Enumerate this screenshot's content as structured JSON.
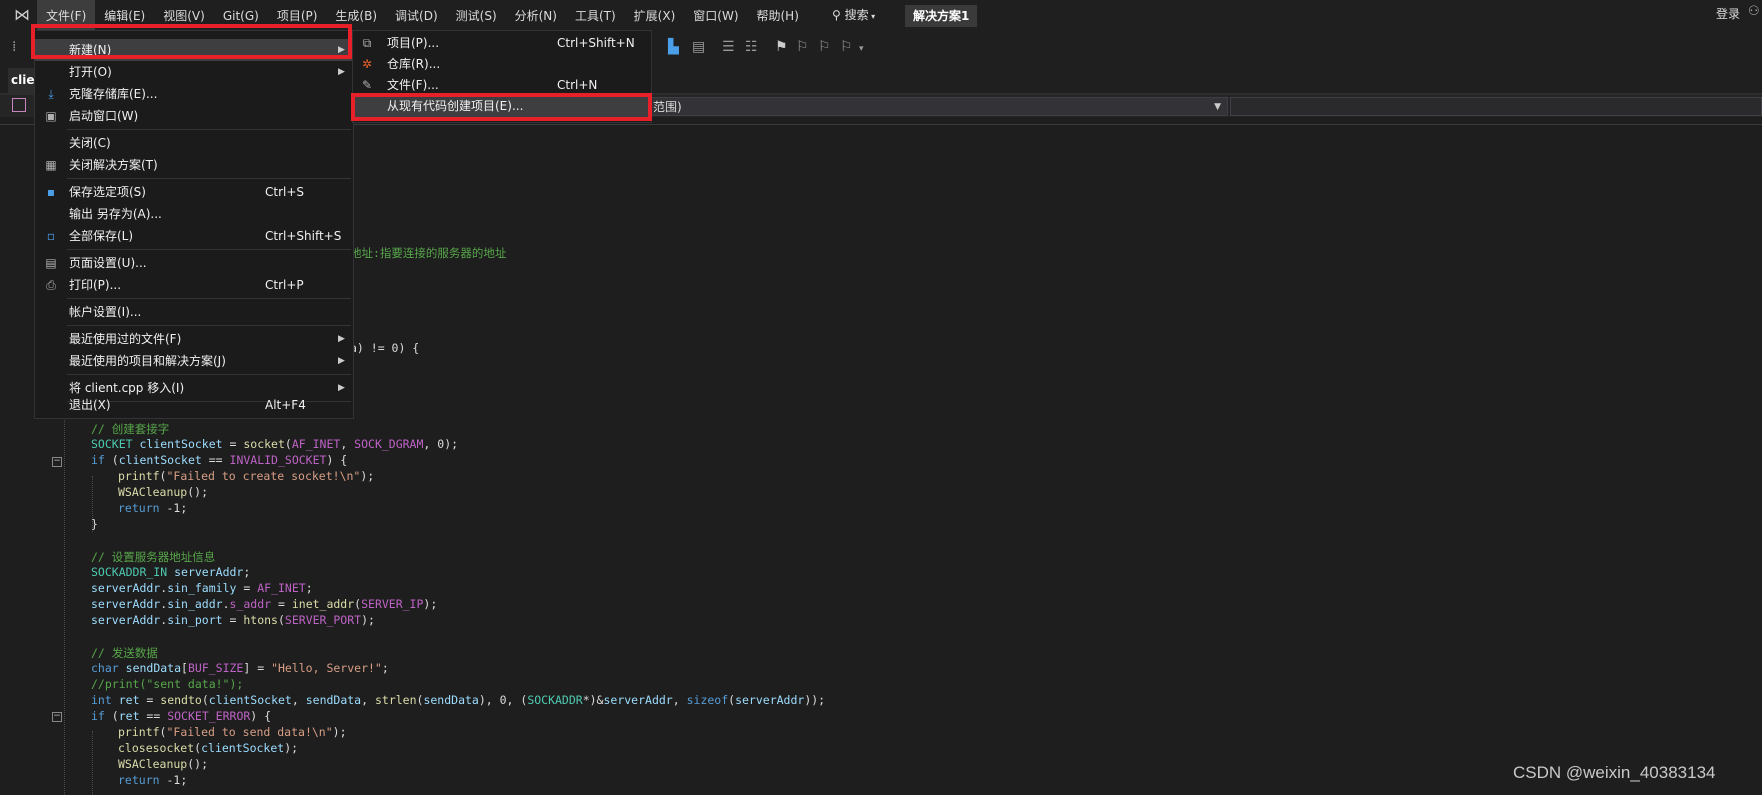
{
  "menubar": {
    "items": [
      "文件(F)",
      "编辑(E)",
      "视图(V)",
      "Git(G)",
      "项目(P)",
      "生成(B)",
      "调试(D)",
      "测试(S)",
      "分析(N)",
      "工具(T)",
      "扩展(X)",
      "窗口(W)",
      "帮助(H)"
    ],
    "search_label": "搜索",
    "solution_name": "解决方案1",
    "login_label": "登录"
  },
  "tab": {
    "title": "clie"
  },
  "navbar": {
    "scope": "局范围)"
  },
  "file_menu": {
    "items": [
      {
        "label": "新建(N)",
        "shortcut": "",
        "submenu": true,
        "icon": ""
      },
      {
        "label": "打开(O)",
        "shortcut": "",
        "submenu": true,
        "icon": ""
      },
      {
        "label": "克隆存储库(E)...",
        "shortcut": "",
        "submenu": false,
        "icon": "clone-icon"
      },
      {
        "label": "启动窗口(W)",
        "shortcut": "",
        "submenu": false,
        "icon": "start-window-icon"
      },
      {
        "label": "关闭(C)",
        "shortcut": "",
        "submenu": false,
        "icon": ""
      },
      {
        "label": "关闭解决方案(T)",
        "shortcut": "",
        "submenu": false,
        "icon": "close-solution-icon"
      },
      {
        "label": "保存选定项(S)",
        "shortcut": "Ctrl+S",
        "submenu": false,
        "icon": "save-icon"
      },
      {
        "label": "输出 另存为(A)...",
        "shortcut": "",
        "submenu": false,
        "icon": ""
      },
      {
        "label": "全部保存(L)",
        "shortcut": "Ctrl+Shift+S",
        "submenu": false,
        "icon": "save-all-icon"
      },
      {
        "label": "页面设置(U)...",
        "shortcut": "",
        "submenu": false,
        "icon": "page-setup-icon"
      },
      {
        "label": "打印(P)...",
        "shortcut": "Ctrl+P",
        "submenu": false,
        "icon": "print-icon"
      },
      {
        "label": "帐户设置(I)...",
        "shortcut": "",
        "submenu": false,
        "icon": ""
      },
      {
        "label": "最近使用过的文件(F)",
        "shortcut": "",
        "submenu": true,
        "icon": ""
      },
      {
        "label": "最近使用的项目和解决方案(J)",
        "shortcut": "",
        "submenu": true,
        "icon": ""
      },
      {
        "label": "将 client.cpp 移入(I)",
        "shortcut": "",
        "submenu": true,
        "icon": ""
      },
      {
        "label": "退出(X)",
        "shortcut": "Alt+F4",
        "submenu": false,
        "icon": ""
      }
    ]
  },
  "new_submenu": {
    "items": [
      {
        "label": "项目(P)...",
        "shortcut": "Ctrl+Shift+N",
        "icon": "new-project-icon"
      },
      {
        "label": "仓库(R)...",
        "shortcut": "",
        "icon": "repository-icon"
      },
      {
        "label": "文件(F)...",
        "shortcut": "Ctrl+N",
        "icon": "new-file-icon"
      },
      {
        "label": "从现有代码创建项目(E)...",
        "shortcut": "",
        "icon": ""
      }
    ]
  },
  "code": {
    "frag1": "地址:指要连接的服务器的地址",
    "frag2": "a) != 0) {",
    "c_socket": "// 创建套接字",
    "c_server": "// 设置服务器地址信息",
    "c_send": "// 发送数据",
    "c_printsent": "//print(\"sent data!\");"
  },
  "watermark": "CSDN @weixin_40383134"
}
